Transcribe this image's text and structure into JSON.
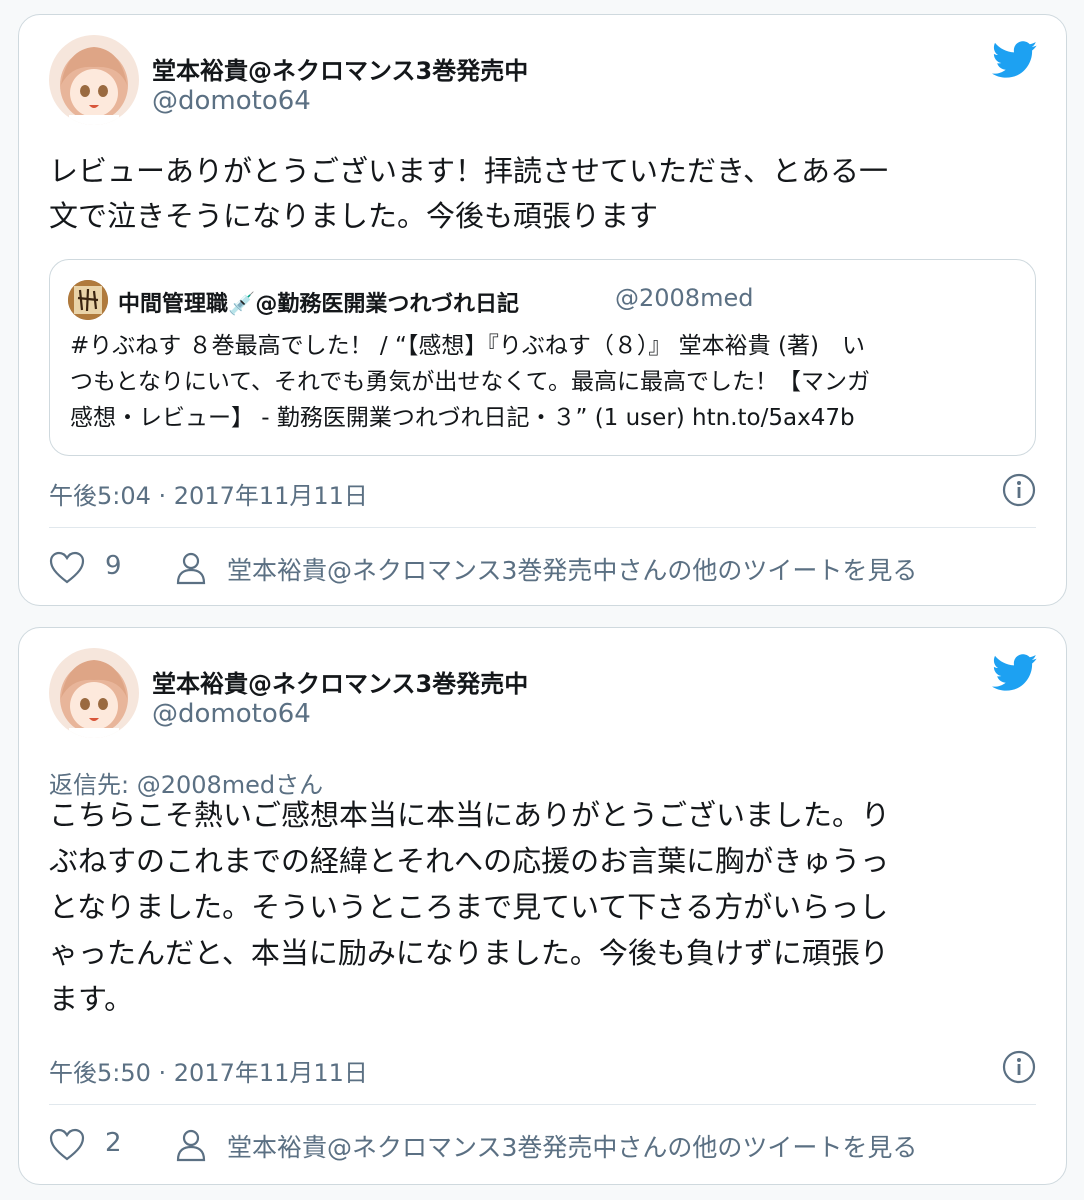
{
  "tweets": [
    {
      "author": {
        "display_name": "堂本裕貴@ネクロマンス3巻発売中",
        "handle": "@domoto64",
        "avatar_icon": "anime-girl-avatar"
      },
      "text": "レビューありがとうございます！拝読させていただき、とある一\n文で泣きそうになりました。今後も頑張ります",
      "quote": {
        "display_name": "中間管理職💉@勤務医開業つれづれ日記",
        "handle": "@2008med",
        "text": "#りぶねす ８巻最高でした！ / “【感想】『りぶねす（８）』 堂本裕貴 (著)　い\nつもとなりにいて、それでも勇気が出せなくて。最高に最高でした！【マンガ\n感想・レビュー】 - 勤務医開業つれづれ日記・３” (1 user) htn.to/5ax47b"
      },
      "timestamp": "午後5:04 · 2017年11月11日",
      "likes": "9",
      "more_link": "堂本裕貴@ネクロマンス3巻発売中さんの他のツイートを見る"
    },
    {
      "author": {
        "display_name": "堂本裕貴@ネクロマンス3巻発売中",
        "handle": "@domoto64",
        "avatar_icon": "anime-girl-avatar"
      },
      "reply_to": "返信先: @2008medさん",
      "text": "こちらこそ熱いご感想本当に本当にありがとうございました。り\nぶねすのこれまでの経緯とそれへの応援のお言葉に胸がきゅうっ\nとなりました。そういうところまで見ていて下さる方がいらっし\nゃったんだと、本当に励みになりました。今後も負けずに頑張り\nます。",
      "timestamp": "午後5:50 · 2017年11月11日",
      "likes": "2",
      "more_link": "堂本裕貴@ネクロマンス3巻発売中さんの他のツイートを見る"
    }
  ],
  "colors": {
    "twitter_blue": "#1da1f2",
    "secondary_text": "#5b7083",
    "border": "#cfd9de"
  }
}
